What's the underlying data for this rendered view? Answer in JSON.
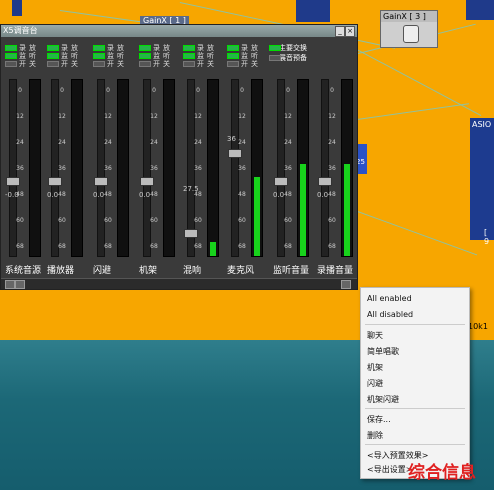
{
  "desktop": {
    "gainx_window_title": "GainX [ 3 ]",
    "gainx_mini_title": "GainX [ 1 ]",
    "asio_label": "ASIO",
    "side_num": "[ 9",
    "lock_text": "25",
    "tag_10k": "10k1"
  },
  "mixer": {
    "title": "X5调音台",
    "switch_labels": [
      "录",
      "放",
      "监",
      "听",
      "开",
      "关"
    ],
    "master_labels": [
      "主要交换",
      "展音预备"
    ],
    "tick_values": [
      "0",
      "12",
      "24",
      "36",
      "48",
      "60",
      "68"
    ],
    "channels": [
      {
        "name": "系统音源",
        "value": "-0.0",
        "level": 0.0
      },
      {
        "name": "播放器",
        "value": "0.0",
        "level": 0.0
      },
      {
        "name": "闪避",
        "value": "0.0",
        "level": 0.0
      },
      {
        "name": "机架",
        "value": "0.0",
        "level": 0.0
      },
      {
        "name": "混响",
        "value": "27.5",
        "level": 0.08
      },
      {
        "name": "麦克风",
        "value": "36",
        "level": 0.45
      },
      {
        "name": "监听音量",
        "value": "0.0",
        "level": 0.52
      },
      {
        "name": "录播音量",
        "value": "0.0",
        "level": 0.52
      }
    ]
  },
  "context_menu": {
    "items": [
      {
        "label": "All enabled"
      },
      {
        "label": "All disabled"
      },
      {
        "label": "聊天"
      },
      {
        "label": "简单唱歌"
      },
      {
        "label": "机架"
      },
      {
        "label": "闪避"
      },
      {
        "label": "机架闪避"
      },
      {
        "label": "保存..."
      },
      {
        "label": "删除"
      },
      {
        "label": "<导入预置效果>"
      },
      {
        "label": "<导出设置>"
      }
    ]
  },
  "watermark": "综合信息"
}
